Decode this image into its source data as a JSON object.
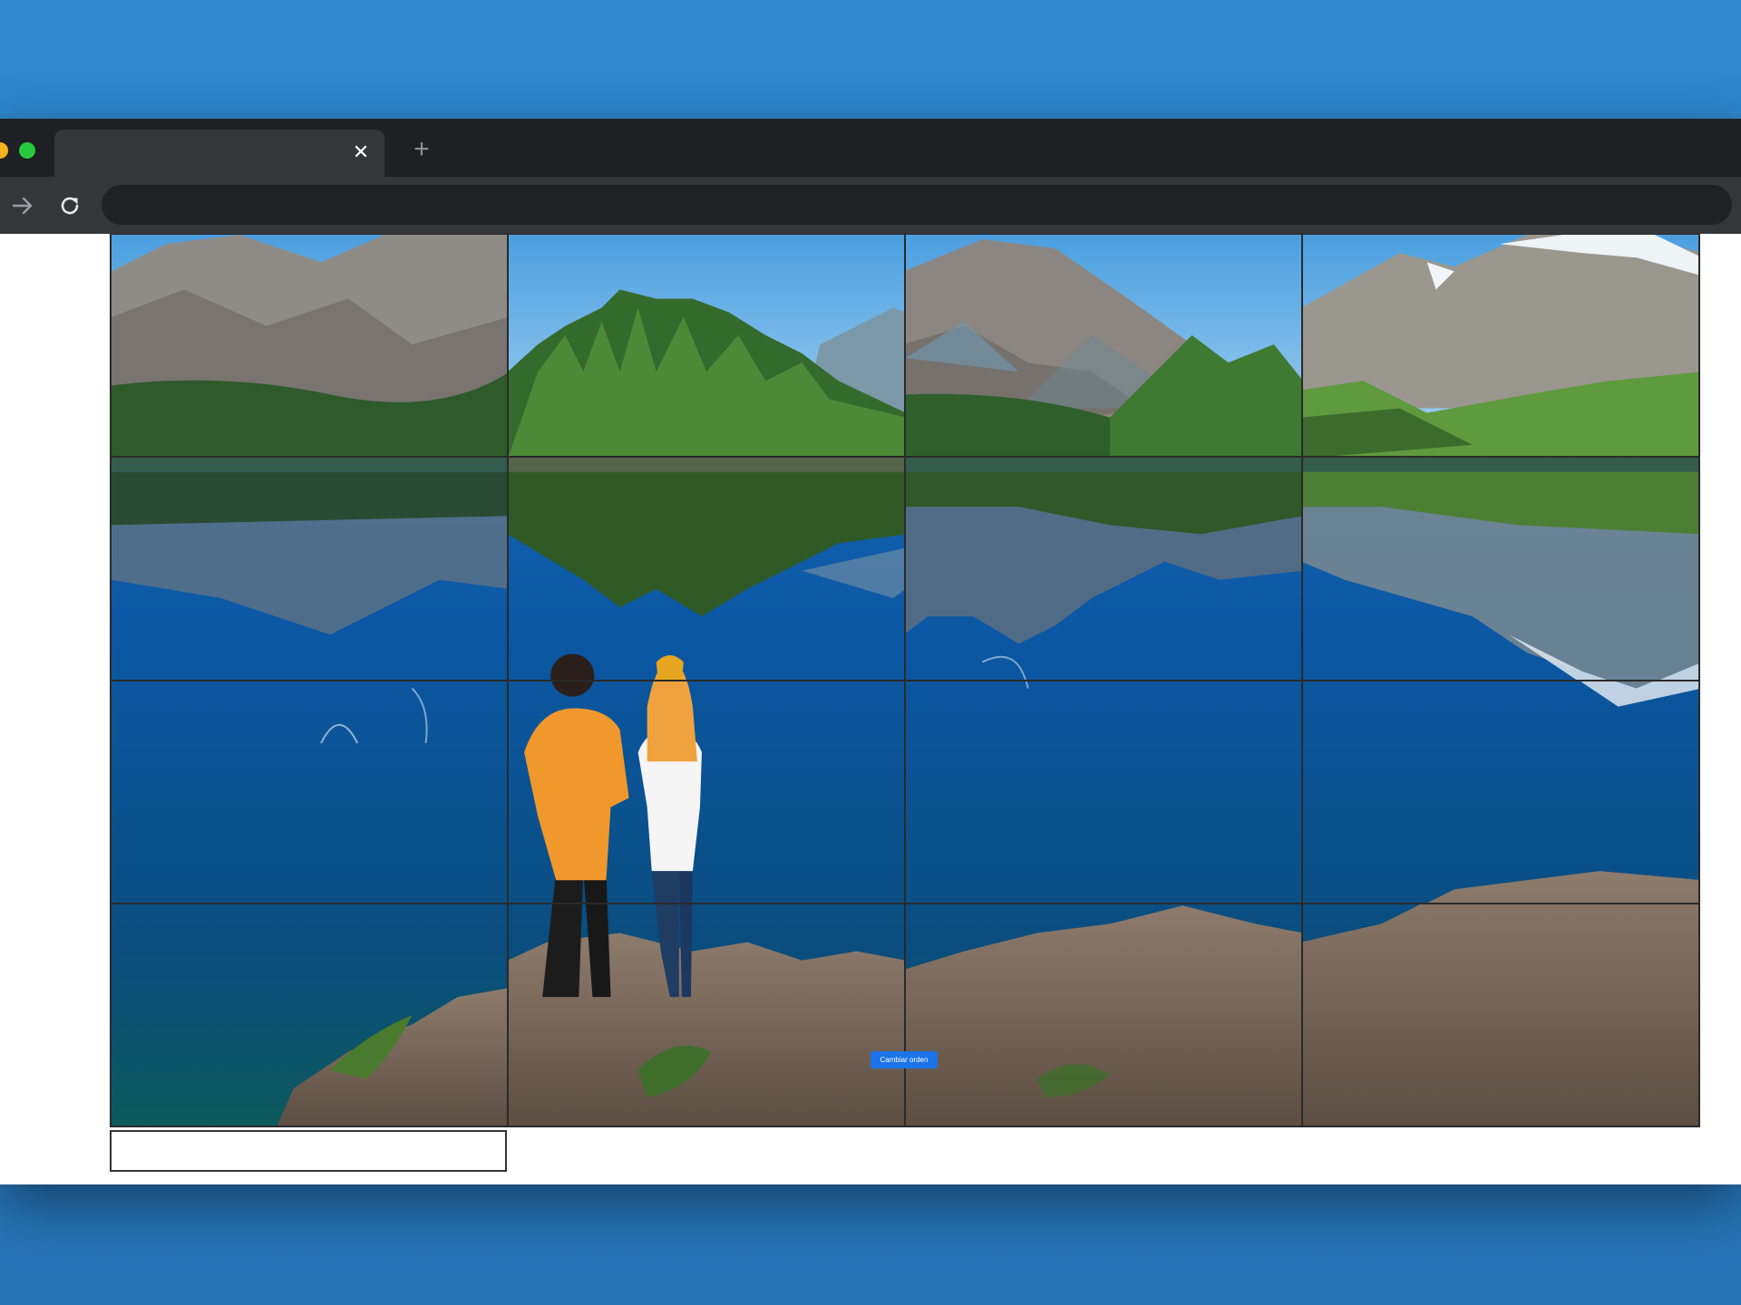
{
  "browser": {
    "tab_title": "",
    "address": "",
    "close_glyph": "✕",
    "new_tab_glyph": "+"
  },
  "puzzle": {
    "rows": 4,
    "cols": 4,
    "picture": "lake with mountain reflections and two people standing on a rock",
    "tiles_placed": 16
  },
  "controls": {
    "shuffle_label": "Cambiar orden"
  },
  "icons": {
    "forward": "arrow-right-icon",
    "reload": "reload-icon",
    "close": "close-icon",
    "new_tab": "plus-icon"
  },
  "colors": {
    "desktop": "#2a7fc6",
    "titlebar": "#1f2023",
    "toolbar": "#35363a",
    "button": "#1a73e8"
  }
}
